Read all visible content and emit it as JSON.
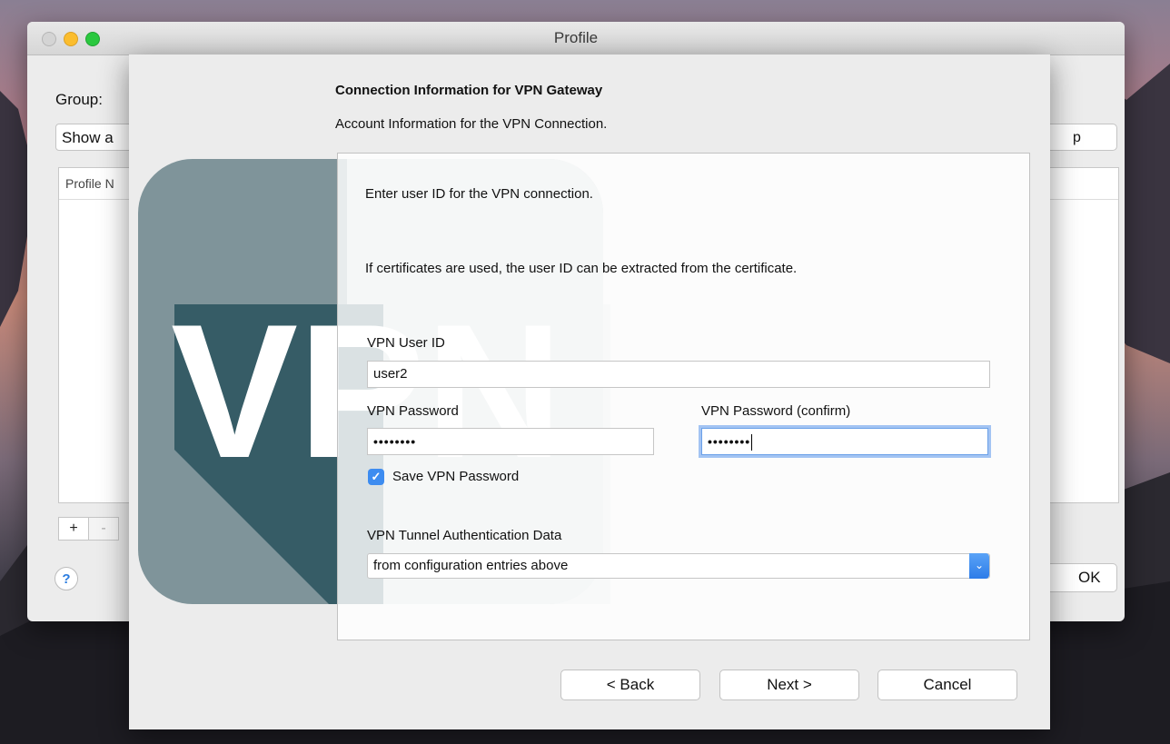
{
  "back_window": {
    "title": "Profile",
    "group_label": "Group:",
    "group_value": "Show a",
    "right_button_label": "p",
    "table_header": "Profile N",
    "add_label": "+",
    "remove_label": "-",
    "help_label": "?",
    "ok_label": "OK"
  },
  "sheet": {
    "heading": "Connection Information for VPN Gateway",
    "subheading": "Account Information for the VPN Connection.",
    "logo_text": "VPN",
    "intro_text": "Enter user ID for the VPN connection.",
    "cert_text": "If certificates are used, the user ID can be extracted from the certificate.",
    "user_id_label": "VPN User ID",
    "user_id_value": "user2",
    "password_label": "VPN Password",
    "password_value": "••••••••",
    "password_confirm_label": "VPN Password (confirm)",
    "password_confirm_value": "••••••••",
    "save_password_label": "Save VPN Password",
    "save_password_checked": true,
    "tunnel_auth_label": "VPN Tunnel Authentication Data",
    "tunnel_auth_value": "from configuration entries above",
    "back_label": "< Back",
    "next_label": "Next >",
    "cancel_label": "Cancel"
  },
  "colors": {
    "accent": "#3d8cf0",
    "logo_dark": "#365c66",
    "logo_mid": "#7f949a",
    "logo_light": "#c7cfd2"
  }
}
